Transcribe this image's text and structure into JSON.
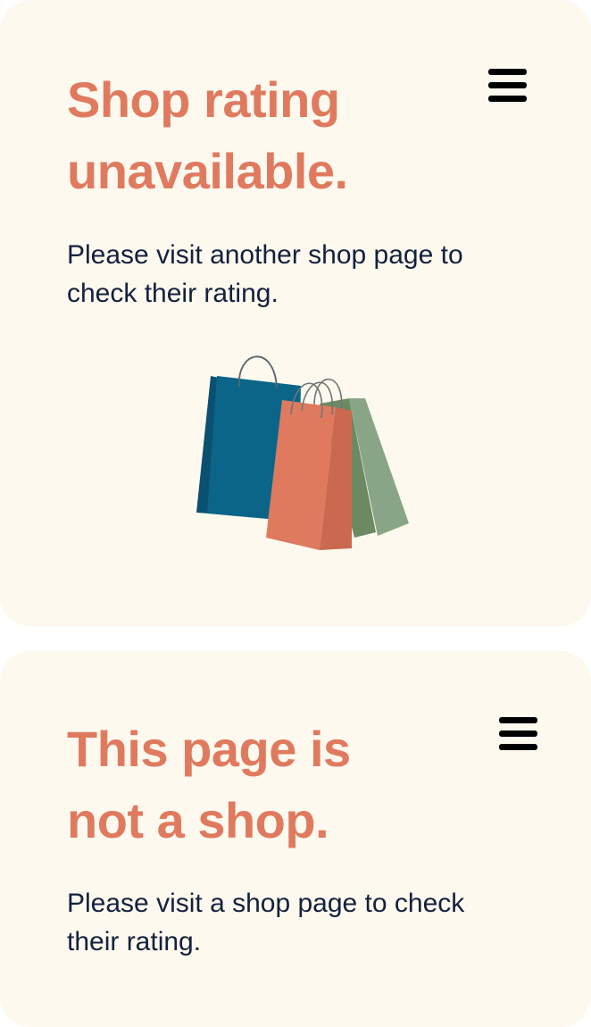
{
  "cards": [
    {
      "title_line1": "Shop rating",
      "title_line2": "unavailable.",
      "body_line1": "Please visit another shop page to",
      "body_line2": "check their rating.",
      "menu_icon": "hamburger-menu-icon",
      "illustration": "shopping-bags-icon"
    },
    {
      "title_line1": "This page is",
      "title_line2": "not a shop.",
      "body_line1": "Please visit a shop page to check",
      "body_line2": "their rating.",
      "menu_icon": "hamburger-menu-icon"
    }
  ],
  "colors": {
    "card_background": "#fdf9ef",
    "title": "#e07a5f",
    "body_text": "#14213d",
    "bag_blue": "#0b6589",
    "bag_orange": "#e07a5f",
    "bag_green": "#89a587"
  }
}
